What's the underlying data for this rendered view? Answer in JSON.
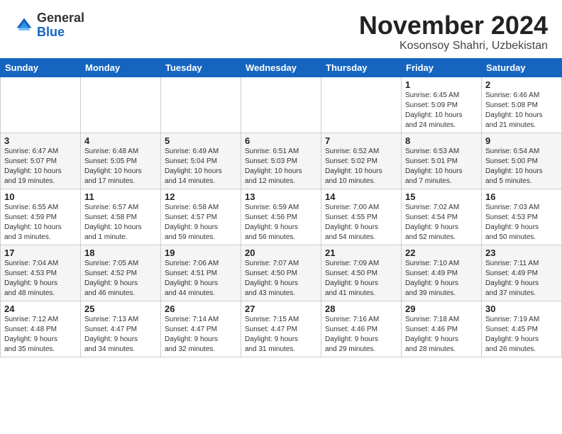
{
  "logo": {
    "general": "General",
    "blue": "Blue"
  },
  "title": "November 2024",
  "subtitle": "Kosonsoy Shahri, Uzbekistan",
  "days_of_week": [
    "Sunday",
    "Monday",
    "Tuesday",
    "Wednesday",
    "Thursday",
    "Friday",
    "Saturday"
  ],
  "weeks": [
    [
      {
        "day": "",
        "info": ""
      },
      {
        "day": "",
        "info": ""
      },
      {
        "day": "",
        "info": ""
      },
      {
        "day": "",
        "info": ""
      },
      {
        "day": "",
        "info": ""
      },
      {
        "day": "1",
        "info": "Sunrise: 6:45 AM\nSunset: 5:09 PM\nDaylight: 10 hours\nand 24 minutes."
      },
      {
        "day": "2",
        "info": "Sunrise: 6:46 AM\nSunset: 5:08 PM\nDaylight: 10 hours\nand 21 minutes."
      }
    ],
    [
      {
        "day": "3",
        "info": "Sunrise: 6:47 AM\nSunset: 5:07 PM\nDaylight: 10 hours\nand 19 minutes."
      },
      {
        "day": "4",
        "info": "Sunrise: 6:48 AM\nSunset: 5:05 PM\nDaylight: 10 hours\nand 17 minutes."
      },
      {
        "day": "5",
        "info": "Sunrise: 6:49 AM\nSunset: 5:04 PM\nDaylight: 10 hours\nand 14 minutes."
      },
      {
        "day": "6",
        "info": "Sunrise: 6:51 AM\nSunset: 5:03 PM\nDaylight: 10 hours\nand 12 minutes."
      },
      {
        "day": "7",
        "info": "Sunrise: 6:52 AM\nSunset: 5:02 PM\nDaylight: 10 hours\nand 10 minutes."
      },
      {
        "day": "8",
        "info": "Sunrise: 6:53 AM\nSunset: 5:01 PM\nDaylight: 10 hours\nand 7 minutes."
      },
      {
        "day": "9",
        "info": "Sunrise: 6:54 AM\nSunset: 5:00 PM\nDaylight: 10 hours\nand 5 minutes."
      }
    ],
    [
      {
        "day": "10",
        "info": "Sunrise: 6:55 AM\nSunset: 4:59 PM\nDaylight: 10 hours\nand 3 minutes."
      },
      {
        "day": "11",
        "info": "Sunrise: 6:57 AM\nSunset: 4:58 PM\nDaylight: 10 hours\nand 1 minute."
      },
      {
        "day": "12",
        "info": "Sunrise: 6:58 AM\nSunset: 4:57 PM\nDaylight: 9 hours\nand 59 minutes."
      },
      {
        "day": "13",
        "info": "Sunrise: 6:59 AM\nSunset: 4:56 PM\nDaylight: 9 hours\nand 56 minutes."
      },
      {
        "day": "14",
        "info": "Sunrise: 7:00 AM\nSunset: 4:55 PM\nDaylight: 9 hours\nand 54 minutes."
      },
      {
        "day": "15",
        "info": "Sunrise: 7:02 AM\nSunset: 4:54 PM\nDaylight: 9 hours\nand 52 minutes."
      },
      {
        "day": "16",
        "info": "Sunrise: 7:03 AM\nSunset: 4:53 PM\nDaylight: 9 hours\nand 50 minutes."
      }
    ],
    [
      {
        "day": "17",
        "info": "Sunrise: 7:04 AM\nSunset: 4:53 PM\nDaylight: 9 hours\nand 48 minutes."
      },
      {
        "day": "18",
        "info": "Sunrise: 7:05 AM\nSunset: 4:52 PM\nDaylight: 9 hours\nand 46 minutes."
      },
      {
        "day": "19",
        "info": "Sunrise: 7:06 AM\nSunset: 4:51 PM\nDaylight: 9 hours\nand 44 minutes."
      },
      {
        "day": "20",
        "info": "Sunrise: 7:07 AM\nSunset: 4:50 PM\nDaylight: 9 hours\nand 43 minutes."
      },
      {
        "day": "21",
        "info": "Sunrise: 7:09 AM\nSunset: 4:50 PM\nDaylight: 9 hours\nand 41 minutes."
      },
      {
        "day": "22",
        "info": "Sunrise: 7:10 AM\nSunset: 4:49 PM\nDaylight: 9 hours\nand 39 minutes."
      },
      {
        "day": "23",
        "info": "Sunrise: 7:11 AM\nSunset: 4:49 PM\nDaylight: 9 hours\nand 37 minutes."
      }
    ],
    [
      {
        "day": "24",
        "info": "Sunrise: 7:12 AM\nSunset: 4:48 PM\nDaylight: 9 hours\nand 35 minutes."
      },
      {
        "day": "25",
        "info": "Sunrise: 7:13 AM\nSunset: 4:47 PM\nDaylight: 9 hours\nand 34 minutes."
      },
      {
        "day": "26",
        "info": "Sunrise: 7:14 AM\nSunset: 4:47 PM\nDaylight: 9 hours\nand 32 minutes."
      },
      {
        "day": "27",
        "info": "Sunrise: 7:15 AM\nSunset: 4:47 PM\nDaylight: 9 hours\nand 31 minutes."
      },
      {
        "day": "28",
        "info": "Sunrise: 7:16 AM\nSunset: 4:46 PM\nDaylight: 9 hours\nand 29 minutes."
      },
      {
        "day": "29",
        "info": "Sunrise: 7:18 AM\nSunset: 4:46 PM\nDaylight: 9 hours\nand 28 minutes."
      },
      {
        "day": "30",
        "info": "Sunrise: 7:19 AM\nSunset: 4:45 PM\nDaylight: 9 hours\nand 26 minutes."
      }
    ]
  ]
}
